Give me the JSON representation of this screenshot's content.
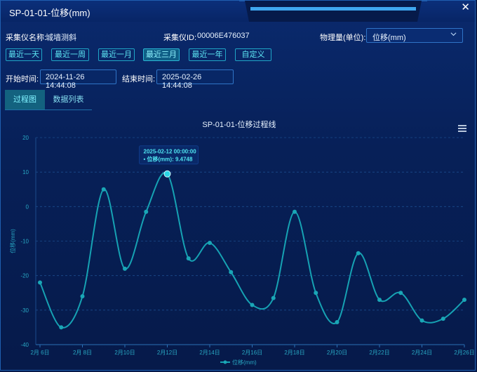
{
  "window": {
    "title": "SP-01-01-位移(mm)",
    "close_glyph": "✕"
  },
  "info": {
    "device_name_label": "采集仪名称:",
    "device_name_value": "城墙测斜",
    "device_id_label": "采集仪ID:",
    "device_id_value": "00006E476037",
    "quantity_label": "物理量(单位):",
    "quantity_value": "位移(mm)"
  },
  "quick_ranges": [
    "最近一天",
    "最近一周",
    "最近一月",
    "最近三月",
    "最近一年",
    "自定义"
  ],
  "quick_active_index": 3,
  "time": {
    "start_label": "开始时间:",
    "start_value": "2024-11-26 14:44:08",
    "end_label": "结束时间:",
    "end_value": "2025-02-26 14:44:08"
  },
  "tabs": [
    "过程图",
    "数据列表"
  ],
  "tab_active_index": 0,
  "colors": {
    "accent": "#1fb3c4",
    "line": "#16a2b3",
    "point": "#1aa6b6",
    "grid": "#1b4b8c",
    "axis_text": "#28a7c2"
  },
  "chart_data": {
    "type": "line",
    "title": "SP-01-01-位移过程线",
    "ylabel": "位移(mm)",
    "xlabel": "",
    "ylim": [
      -40,
      20
    ],
    "yticks": [
      20,
      10,
      0,
      -10,
      -20,
      -30,
      -40
    ],
    "xtick_labels": [
      "2月 6日",
      "2月 8日",
      "2月10日",
      "2月12日",
      "2月14日",
      "2月16日",
      "2月18日",
      "2月20日",
      "2月22日",
      "2月24日",
      "2月26日"
    ],
    "xtick_days": [
      0,
      2,
      4,
      6,
      8,
      10,
      12,
      14,
      16,
      18,
      20
    ],
    "legend": "位移(mm)",
    "legend_position": "bottom-center",
    "menu_icon": "menu-icon",
    "series": [
      {
        "name": "位移(mm)",
        "x": [
          0,
          1,
          2,
          3,
          4,
          5,
          6,
          7,
          8,
          9,
          10,
          11,
          12,
          13,
          14,
          15,
          16,
          17,
          18,
          19,
          20
        ],
        "values": [
          -22,
          -35,
          -26,
          5,
          -18,
          -1.5,
          9.4748,
          -15,
          -10.5,
          -19,
          -28.5,
          -26.5,
          -1.5,
          -25,
          -33.5,
          -13.5,
          -27,
          -25,
          -33,
          -32.5,
          -27
        ]
      }
    ],
    "tooltip": {
      "index": 6,
      "date": "2025-02-12 00:00:00",
      "series_label": "位移(mm):",
      "value": "9.4748"
    }
  }
}
